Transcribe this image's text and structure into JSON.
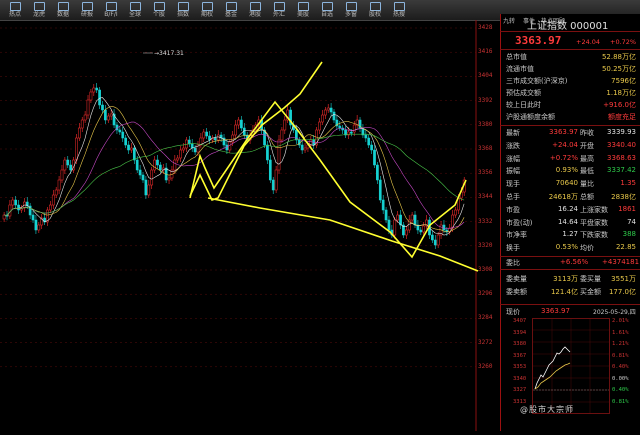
{
  "toolbar": {
    "items": [
      {
        "label": "热点",
        "icon": "hot-icon"
      },
      {
        "label": "龙虎",
        "icon": "dragon-icon"
      },
      {
        "label": "数据",
        "icon": "data-icon"
      },
      {
        "label": "研报",
        "icon": "report-icon"
      },
      {
        "label": "B/F/I",
        "icon": "index-icon"
      },
      {
        "label": "全球",
        "icon": "globe-icon"
      },
      {
        "label": "个股",
        "icon": "stock-icon"
      },
      {
        "label": "指数",
        "icon": "index-chart-icon"
      },
      {
        "label": "期权",
        "icon": "option-icon"
      },
      {
        "label": "基金",
        "icon": "fund-icon"
      },
      {
        "label": "港股",
        "icon": "hk-icon"
      },
      {
        "label": "外汇",
        "icon": "fx-icon"
      },
      {
        "label": "美股",
        "icon": "us-icon"
      },
      {
        "label": "自选",
        "icon": "star-icon"
      },
      {
        "label": "多窗",
        "icon": "windows-icon"
      },
      {
        "label": "股权",
        "icon": "equity-icon"
      },
      {
        "label": "热搜",
        "icon": "search-hot-icon"
      }
    ]
  },
  "chart": {
    "y_ticks": [
      "3428",
      "3416",
      "3404",
      "3392",
      "3380",
      "3368",
      "3356",
      "3344",
      "3332",
      "3320",
      "3308",
      "3296",
      "3284",
      "3272",
      "3260"
    ],
    "high_label": "3417.31"
  },
  "panel": {
    "tabs": [
      "九转",
      "事件",
      "热点回顾"
    ],
    "title": "上证指数 000001",
    "price": "3363.97",
    "change": "+24.04",
    "change_pct": "+0.72%",
    "rows_a": [
      {
        "label": "总市值",
        "value": "52.88万亿",
        "cls": "yel"
      },
      {
        "label": "流通市值",
        "value": "50.25万亿",
        "cls": "yel"
      },
      {
        "label": "三市成交额(沪深京)",
        "value": "7596亿",
        "cls": "yel"
      },
      {
        "label": "预估成交额",
        "value": "1.18万亿",
        "cls": "yel"
      },
      {
        "label": "较上日此时",
        "value": "+916.0亿",
        "cls": "red"
      },
      {
        "label": "沪股通额度余额",
        "value": "额度充足",
        "cls": "red"
      }
    ],
    "rows_b": [
      {
        "l1": "最新",
        "v1": "3363.97",
        "c1": "red",
        "l2": "昨收",
        "v2": "3339.93",
        "c2": "wht"
      },
      {
        "l1": "涨跌",
        "v1": "+24.04",
        "c1": "red",
        "l2": "开盘",
        "v2": "3340.40",
        "c2": "red"
      },
      {
        "l1": "涨幅",
        "v1": "+0.72%",
        "c1": "red",
        "l2": "最高",
        "v2": "3368.63",
        "c2": "red"
      },
      {
        "l1": "振幅",
        "v1": "0.93%",
        "c1": "yel",
        "l2": "最低",
        "v2": "3337.42",
        "c2": "grn"
      },
      {
        "l1": "现手",
        "v1": "70640",
        "c1": "yel",
        "l2": "量比",
        "v2": "1.35",
        "c2": "red"
      },
      {
        "l1": "总手",
        "v1": "24618万",
        "c1": "yel",
        "l2": "总额",
        "v2": "2838亿",
        "c2": "yel"
      },
      {
        "l1": "市盈",
        "v1": "16.24",
        "c1": "wht",
        "l2": "上涨家数",
        "v2": "1861",
        "c2": "red"
      },
      {
        "l1": "市盈(动)",
        "v1": "14.64",
        "c1": "wht",
        "l2": "平盘家数",
        "v2": "74",
        "c2": "wht"
      },
      {
        "l1": "市净率",
        "v1": "1.27",
        "c1": "wht",
        "l2": "下跌家数",
        "v2": "388",
        "c2": "grn"
      },
      {
        "l1": "换手",
        "v1": "0.53%",
        "c1": "yel",
        "l2": "均价",
        "v2": "22.85",
        "c2": "yel"
      }
    ],
    "weibi": {
      "label": "委比",
      "value": "+6.56%",
      "value2": "+4374181"
    },
    "rows_c": [
      {
        "l1": "委卖量",
        "v1": "3113万",
        "c1": "yel",
        "l2": "委买量",
        "v2": "3551万",
        "c2": "yel"
      },
      {
        "l1": "委卖额",
        "v1": "121.4亿",
        "c1": "yel",
        "l2": "买金额",
        "v2": "177.0亿",
        "c2": "yel"
      }
    ],
    "mini": {
      "label": "现价",
      "price": "3363.97",
      "date": "2025-05-29,四",
      "y_left": [
        "3407",
        "3394",
        "3380",
        "3367",
        "3353",
        "3340",
        "3327",
        "3313"
      ],
      "y_right": [
        "2.01%",
        "1.61%",
        "1.21%",
        "0.81%",
        "0.40%",
        "0.00%",
        "0.40%",
        "0.81%"
      ]
    },
    "watermark": "@股市大宗师"
  }
}
